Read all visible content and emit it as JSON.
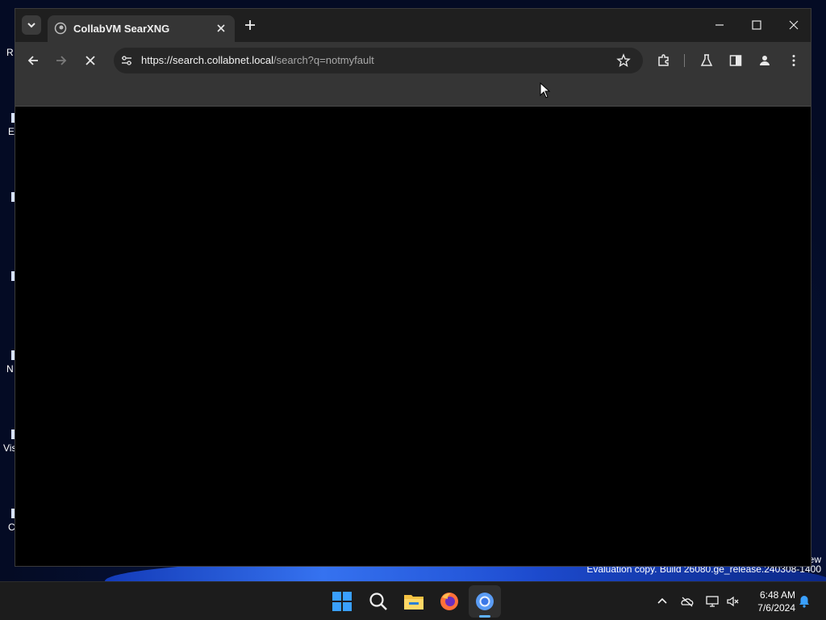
{
  "desktop": {
    "icon_labels": [
      "R",
      "E",
      "",
      "",
      "N",
      "Vis",
      "C"
    ],
    "watermark_line1": "ew",
    "watermark_line2": "Evaluation copy. Build 26080.ge_release.240308-1400"
  },
  "browser": {
    "tab": {
      "title": "CollabVM SearXNG"
    },
    "omnibox": {
      "url_host": "https://search.collabnet.local",
      "url_rest": "/search?q=notmyfault"
    },
    "icons": {
      "tab_search": "chevron-down-icon",
      "favicon": "globe-icon",
      "tab_close": "close-icon",
      "new_tab": "plus-icon",
      "minimize": "minimize-icon",
      "maximize": "maximize-icon",
      "close": "close-icon",
      "back": "back-arrow-icon",
      "forward": "forward-arrow-icon",
      "stop": "stop-icon",
      "site_info": "tune-icon",
      "bookmark": "star-icon",
      "extensions": "puzzle-icon",
      "labs": "flask-icon",
      "side_panel": "side-panel-icon",
      "profile": "person-icon",
      "menu": "kebab-menu-icon"
    }
  },
  "taskbar": {
    "apps": [
      "windows-start-icon",
      "search-icon",
      "file-explorer-icon",
      "firefox-icon",
      "chrome-icon"
    ],
    "active_app": "chrome-icon",
    "tray_icons": [
      "chevron-up-icon",
      "onedrive-icon",
      "network-icon",
      "volume-muted-icon",
      "notification-bell-icon"
    ],
    "clock_time": "6:48 AM",
    "clock_date": "7/6/2024"
  },
  "colors": {
    "accent": "#5fb2ff",
    "toolbar_bg": "#353535",
    "tabbar_bg": "#1f1f1f",
    "content_bg": "#000000"
  }
}
